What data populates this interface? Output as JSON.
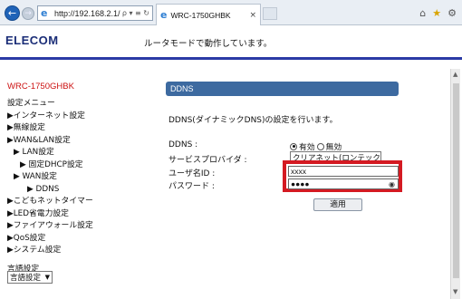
{
  "browser": {
    "address": "http://192.168.2.1/",
    "address_icons": "ρ ▾ ≡ ↻",
    "tab_title": "WRC-1750GHBK",
    "tab_close": "×",
    "right_icons": [
      "home-icon",
      "star-icon",
      "gear-icon"
    ],
    "back_glyph": "←",
    "forward_glyph": "→"
  },
  "header": {
    "logo": "ELECOM",
    "message": "ルータモードで動作しています。"
  },
  "sidebar": {
    "model": "WRC-1750GHBK",
    "menu": [
      {
        "label": "設定メニュー",
        "level": 1
      },
      {
        "label": "▶インターネット設定",
        "level": 1
      },
      {
        "label": "▶無線設定",
        "level": 1
      },
      {
        "label": "▶WAN&LAN設定",
        "level": 1
      },
      {
        "label": "▶ LAN設定",
        "level": 2
      },
      {
        "label": "▶ 固定DHCP設定",
        "level": 3
      },
      {
        "label": "▶ WAN設定",
        "level": 2
      },
      {
        "label": "▶ DDNS",
        "level": 4
      },
      {
        "label": "▶こどもネットタイマー",
        "level": 1
      },
      {
        "label": "▶LED省電力設定",
        "level": 1
      },
      {
        "label": "▶ファイアウォール設定",
        "level": 1
      },
      {
        "label": "▶QoS設定",
        "level": 1
      },
      {
        "label": "▶システム設定",
        "level": 1
      }
    ],
    "language_label": "言語設定",
    "language_select": "言語設定"
  },
  "main": {
    "title": "DDNS",
    "description": "DDNS(ダイナミックDNS)の設定を行います。",
    "ddns_label": "DDNS :",
    "ddns_enabled_label": "有効",
    "ddns_disabled_label": "無効",
    "provider_label": "サービスプロバイダ :",
    "provider_value": "クリアネット(ロンテック)",
    "username_label": "ユーザ名ID :",
    "username_value": "xxxx",
    "password_label": "パスワード :",
    "password_value": "●●●●",
    "apply_label": "適用"
  },
  "colors": {
    "logo": "#1a2d77",
    "model": "#cc1111",
    "panel_title_bg": "#3d6aa0",
    "highlight": "#d41a22",
    "header_line": "#2b3aa5"
  }
}
